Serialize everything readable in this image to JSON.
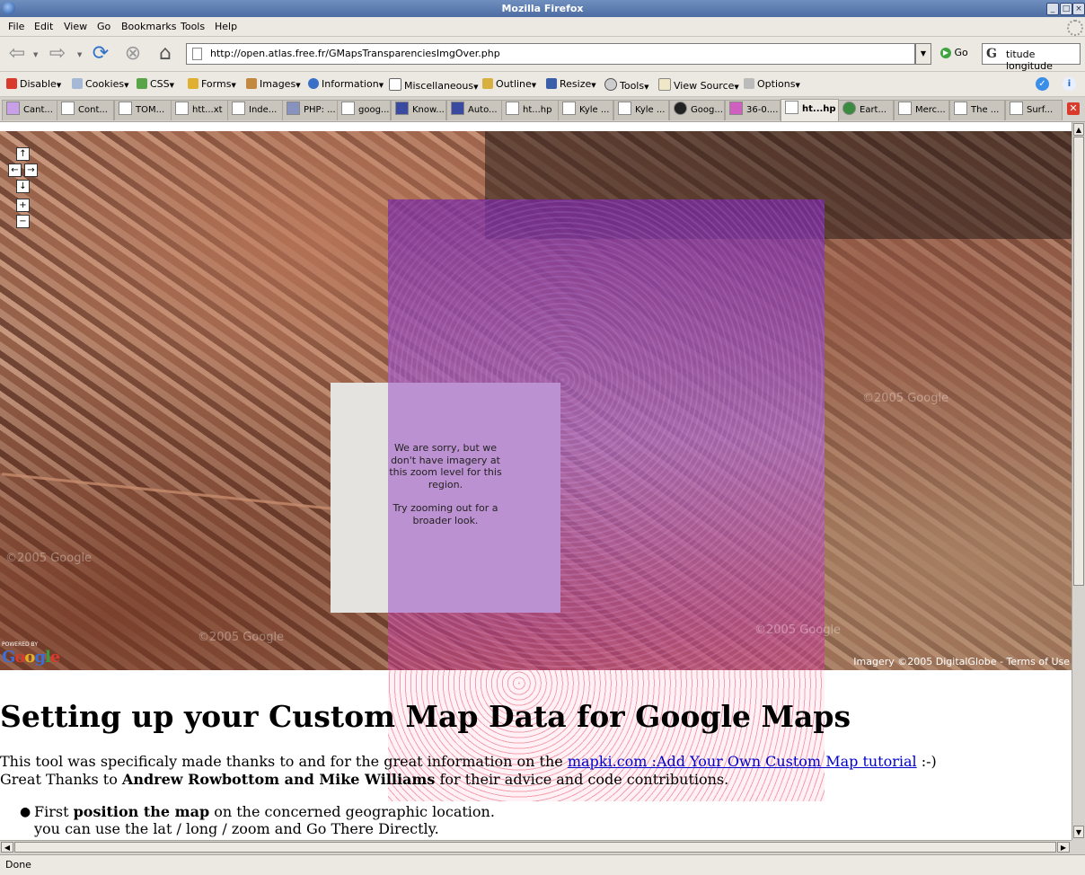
{
  "window": {
    "title": "Mozilla Firefox"
  },
  "menu": [
    "File",
    "Edit",
    "View",
    "Go",
    "Bookmarks",
    "Tools",
    "Help"
  ],
  "nav": {
    "url": "http://open.atlas.free.fr/GMapsTransparenciesImgOver.php",
    "go_label": "Go",
    "search_value": "titude longitude"
  },
  "devtools": [
    "Disable",
    "Cookies",
    "CSS",
    "Forms",
    "Images",
    "Information",
    "Miscellaneous",
    "Outline",
    "Resize",
    "Tools",
    "View Source",
    "Options"
  ],
  "tabs": [
    "Cant...",
    "Cont...",
    "TOM...",
    "htt...xt",
    "Inde...",
    "PHP: ...",
    "goog...",
    "Know...",
    "Auto...",
    "ht...hp",
    "Kyle ...",
    "Kyle ...",
    "Goog...",
    "36-0....",
    "ht...hp",
    "Eart...",
    "Merc...",
    "The ...",
    "Surf..."
  ],
  "map": {
    "no_imagery_line1": "We are sorry, but we don't have imagery at this zoom level for this region.",
    "no_imagery_line2": "Try zooming out for a broader look.",
    "watermark": "©2005 Google",
    "powered_by": "POWERED BY",
    "google_logo": "Google",
    "copyright_text": "Imagery ©2005 DigitalGlobe - ",
    "terms_link": "Terms of Use"
  },
  "page": {
    "heading": "Setting up your Custom Map Data for Google Maps",
    "intro_pre": "This tool was specificaly made thanks to and for the great information on the ",
    "intro_link": "mapki.com :Add Your Own Custom Map tutorial",
    "intro_post": " :-)",
    "thanks_pre": "Great Thanks to ",
    "thanks_names": "Andrew Rowbottom and Mike Williams",
    "thanks_post": " for their advice and code contributions.",
    "bullet1_pre": "First ",
    "bullet1_bold": "position the map",
    "bullet1_post": " on the concerned geographic location.",
    "bullet1_line2": "you can use the lat / long / zoom and Go There Directly."
  },
  "status": "Done"
}
